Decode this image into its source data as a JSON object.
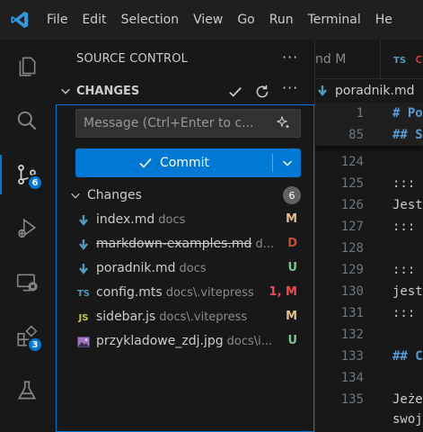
{
  "menu": [
    "File",
    "Edit",
    "Selection",
    "View",
    "Go",
    "Run",
    "Terminal",
    "He"
  ],
  "activity": {
    "scm_badge": "6",
    "extensions_badge": "3"
  },
  "sidebar": {
    "title": "SOURCE CONTROL",
    "section_label": "CHANGES",
    "message_placeholder": "Message (Ctrl+Enter to c...",
    "commit_label": "Commit",
    "group_label": "Changes",
    "group_count": "6",
    "files": [
      {
        "name": "index.md",
        "dir": "docs",
        "status": "M",
        "icon": "markdown-icon",
        "deleted": false
      },
      {
        "name": "markdown-examples.md",
        "dir": "d...",
        "status": "D",
        "icon": "markdown-icon",
        "deleted": true
      },
      {
        "name": "poradnik.md",
        "dir": "docs",
        "status": "U",
        "icon": "markdown-icon",
        "deleted": false
      },
      {
        "name": "config.mts",
        "dir": "docs\\.vitepress",
        "status": "1, M",
        "icon": "typescript-icon",
        "deleted": false
      },
      {
        "name": "sidebar.js",
        "dir": "docs\\.vitepress",
        "status": "M",
        "icon": "javascript-icon",
        "deleted": false
      },
      {
        "name": "przykladowe_zdj.jpg",
        "dir": "docs\\i...",
        "status": "U",
        "icon": "image-icon",
        "deleted": false
      }
    ]
  },
  "editor": {
    "tab1_label": "nd M",
    "tab2_icon": "TS",
    "tab2_label": "co",
    "breadcrumb": "poradnik.md",
    "sticky": [
      {
        "line": "1",
        "text": "# Po"
      },
      {
        "line": "85",
        "text": "## S"
      }
    ],
    "lines": [
      {
        "line": "124",
        "text": ""
      },
      {
        "line": "125",
        "text": "::: "
      },
      {
        "line": "126",
        "text": "Jest"
      },
      {
        "line": "127",
        "text": "::: "
      },
      {
        "line": "128",
        "text": ""
      },
      {
        "line": "129",
        "text": "::: "
      },
      {
        "line": "130",
        "text": "jest"
      },
      {
        "line": "131",
        "text": "::: "
      },
      {
        "line": "132",
        "text": ""
      },
      {
        "line": "133",
        "text": "## C"
      },
      {
        "line": "134",
        "text": ""
      },
      {
        "line": "135",
        "text": "Jeże"
      },
      {
        "line": "",
        "text": "swoj"
      }
    ]
  },
  "colors": {
    "accent": "#0078d4",
    "modified": "#e2c08d",
    "deleted": "#c74e39",
    "untracked": "#73c991",
    "error": "#f14c4c"
  }
}
